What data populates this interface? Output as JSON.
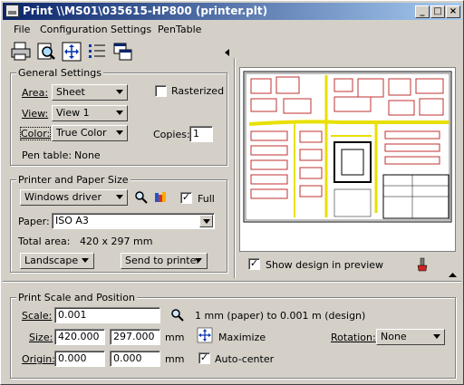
{
  "window": {
    "title": "Print  \\\\MS01\\035615-HP800  (printer.plt)"
  },
  "menu": [
    "File",
    "Configuration",
    "Settings",
    "PenTable"
  ],
  "toolbar": {
    "icons": [
      "printer-icon",
      "preview-icon",
      "fit-icon",
      "list-icon",
      "window-icon"
    ]
  },
  "general": {
    "title": "General Settings",
    "area_label": "Area:",
    "area_value": "Sheet",
    "view_label": "View:",
    "view_value": "View 1",
    "color_label": "Color:",
    "color_value": "True Color",
    "rasterized_label": "Rasterized",
    "copies_label": "Copies:",
    "copies_value": "1",
    "pentable_label": "Pen table:",
    "pentable_value": "None"
  },
  "printer": {
    "title": "Printer and Paper Size",
    "driver_value": "Windows driver",
    "full_label": "Full",
    "paper_label": "Paper:",
    "paper_value": "ISO A3",
    "total_area_label": "Total area:",
    "total_area_value": "420 x 297 mm",
    "orientation_value": "Landscape",
    "send_label": "Send to printer"
  },
  "preview": {
    "show_design_label": "Show design in preview"
  },
  "scale": {
    "title": "Print Scale and Position",
    "scale_label": "Scale:",
    "scale_value": "0.001",
    "scale_desc": "1 mm (paper) to 0.001 m (design)",
    "size_label": "Size:",
    "size_w": "420.000",
    "size_h": "297.000",
    "size_unit": "mm",
    "maximize_label": "Maximize",
    "rotation_label": "Rotation:",
    "rotation_value": "None",
    "origin_label": "Origin:",
    "origin_x": "0.000",
    "origin_y": "0.000",
    "origin_unit": "mm",
    "autocenter_label": "Auto-center"
  }
}
